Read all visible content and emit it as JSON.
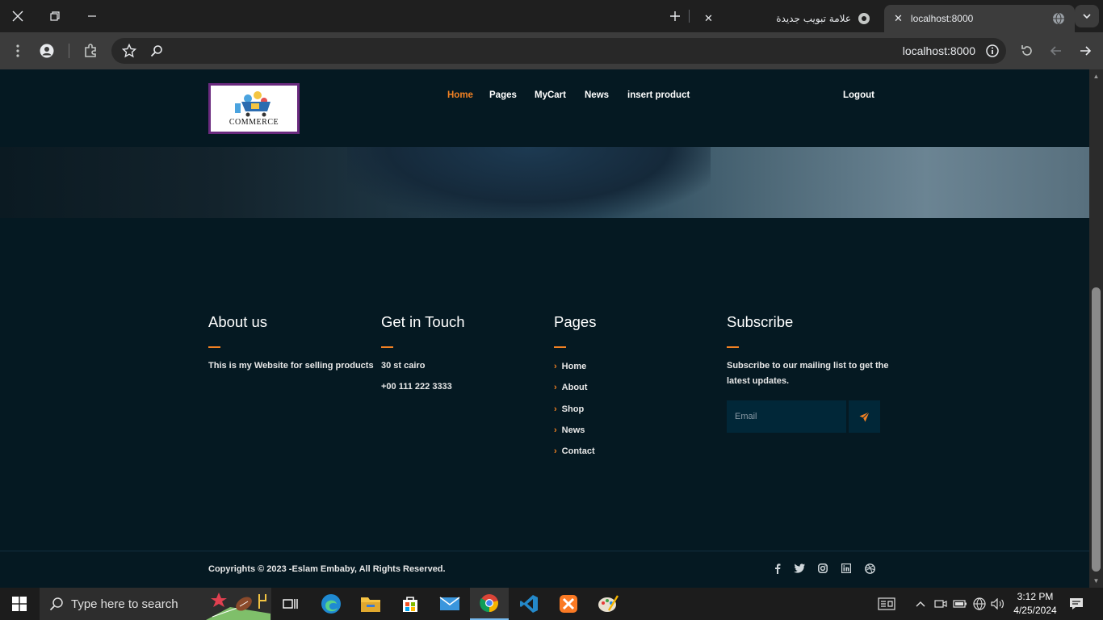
{
  "browser": {
    "active_tab_title": "localhost:8000",
    "inactive_tab_title": "علامة تبويب جديدة",
    "url": "localhost:8000"
  },
  "site": {
    "logo_text": "COMMERCE",
    "nav": [
      {
        "label": "Home",
        "active": true
      },
      {
        "label": "Pages"
      },
      {
        "label": "MyCart"
      },
      {
        "label": "News"
      },
      {
        "label": "insert product"
      }
    ],
    "logout": "Logout"
  },
  "footer": {
    "about": {
      "title": "About us",
      "text": "This is my Website for selling products"
    },
    "contact": {
      "title": "Get in Touch",
      "address": "30 st cairo",
      "phone": "+00 111 222 3333"
    },
    "pages": {
      "title": "Pages",
      "links": [
        "Home",
        "About",
        "Shop",
        "News",
        "Contact"
      ]
    },
    "subscribe": {
      "title": "Subscribe",
      "text_line1": "Subscribe to our mailing list to get the",
      "text_line2": "latest updates.",
      "email_placeholder": "Email"
    },
    "copyright": "Copyrights © 2023 -Eslam Embaby, All Rights Reserved.",
    "social_icons": [
      "facebook-icon",
      "twitter-icon",
      "instagram-icon",
      "linkedin-icon",
      "dribbble-icon"
    ]
  },
  "colors": {
    "accent": "#f28123",
    "background": "#051922",
    "input_bg": "#012738"
  },
  "taskbar": {
    "search_placeholder": "Type here to search",
    "time": "3:12 PM",
    "date": "4/25/2024"
  }
}
